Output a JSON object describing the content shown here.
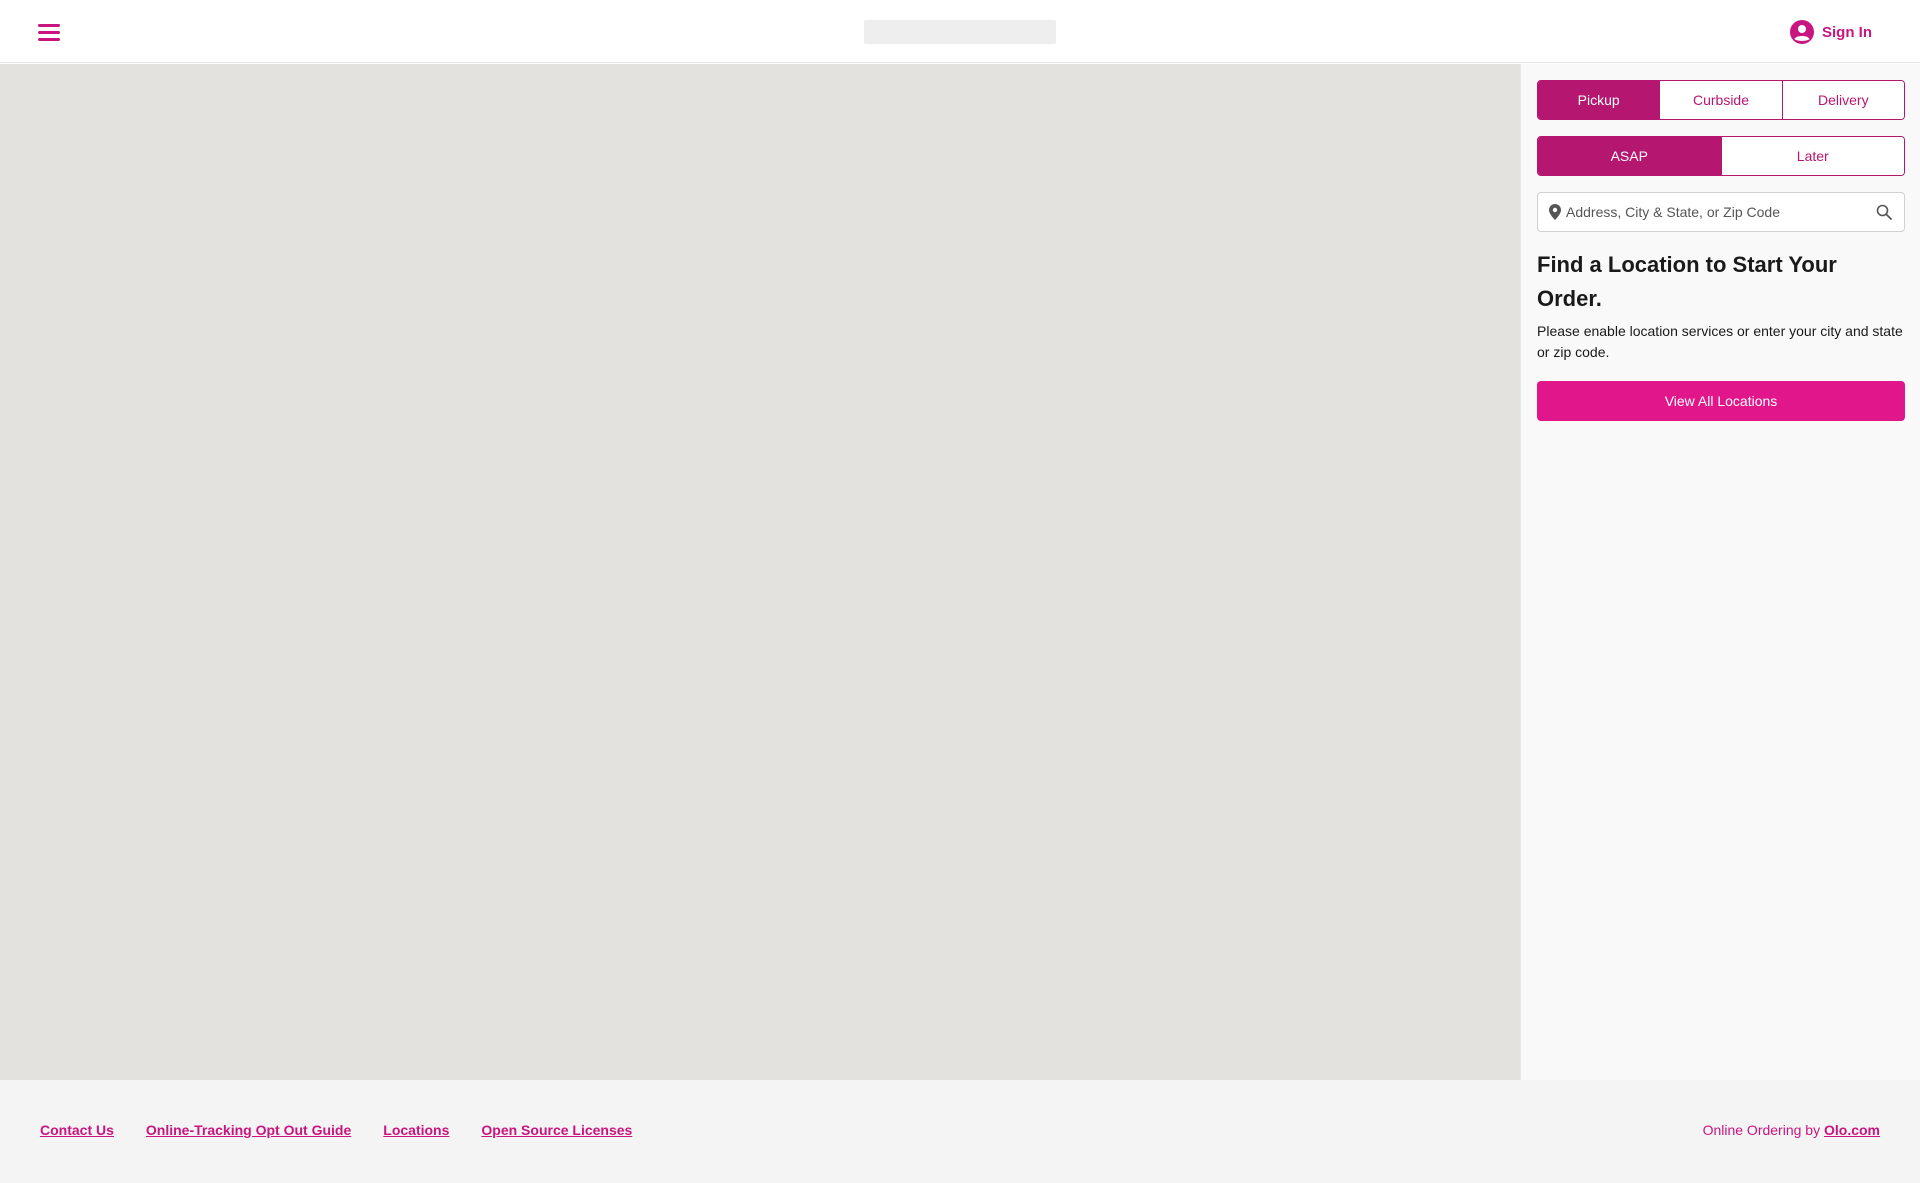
{
  "header": {
    "menu_icon": "hamburger-menu-icon",
    "signin_label": "Sign In",
    "signin_icon": "user-circle-icon"
  },
  "order_type": {
    "options": [
      "Pickup",
      "Curbside",
      "Delivery"
    ],
    "selected": "Pickup"
  },
  "timing": {
    "options": [
      "ASAP",
      "Later"
    ],
    "selected": "ASAP"
  },
  "search": {
    "placeholder": "Address, City & State, or Zip Code",
    "value": ""
  },
  "panel": {
    "heading": "Find a Location to Start Your Order.",
    "description": "Please enable location services or enter your city and state or zip code.",
    "view_all_label": "View All Locations"
  },
  "footer": {
    "links": [
      "Contact Us",
      "Online-Tracking Opt Out Guide",
      "Locations",
      "Open Source Licenses"
    ],
    "credit_prefix": "Online Ordering by",
    "credit_link": "Olo.com"
  },
  "colors": {
    "accent": "#c8157f",
    "button_primary": "#e0168a",
    "segment_active": "#b5166f",
    "map_bg": "#e3e2df"
  }
}
